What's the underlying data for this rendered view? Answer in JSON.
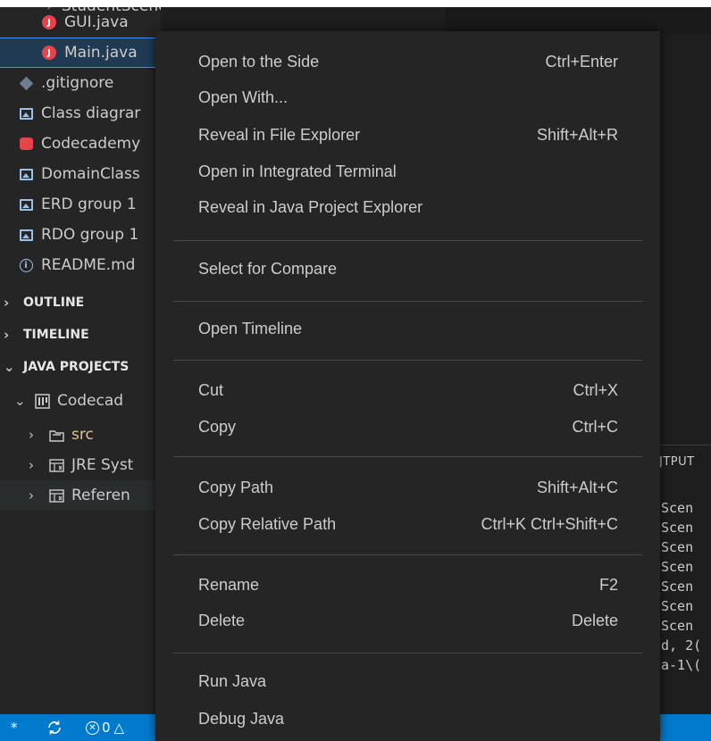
{
  "explorer": {
    "top_partial": "StudentScenes",
    "files": [
      {
        "name": "GUI.java",
        "icon": "java-icon"
      },
      {
        "name": "Main.java",
        "icon": "java-icon"
      },
      {
        "name": ".gitignore",
        "icon": "gitignore-icon"
      },
      {
        "name": "Class diagrar",
        "icon": "image-file-icon"
      },
      {
        "name": "Codecademy",
        "icon": "database-file-icon"
      },
      {
        "name": "DomainClass",
        "icon": "image-file-icon"
      },
      {
        "name": "ERD group 1",
        "icon": "image-file-icon"
      },
      {
        "name": "RDO group 1",
        "icon": "image-file-icon"
      },
      {
        "name": "README.md",
        "icon": "info-icon"
      }
    ],
    "sections": {
      "outline": "OUTLINE",
      "timeline": "TIMELINE",
      "java_projects": "JAVA PROJECTS"
    },
    "project": {
      "name": "Codecad",
      "children": [
        {
          "name": "src",
          "color": "#e2c08d"
        },
        {
          "name": "JRE Syst",
          "color": "#cccccc"
        },
        {
          "name": "Referen",
          "color": "#cccccc"
        }
      ]
    }
  },
  "panel": {
    "tab_label": "JTPUT",
    "lines": [
      "Scen",
      "Scen",
      "Scen",
      "Scen",
      "Scen",
      "Scen",
      "Scen",
      "d, 2(",
      "a-1\\("
    ]
  },
  "statusbar": {
    "left_char": "*",
    "errors": "0",
    "warning_glyph": "△"
  },
  "context_menu": {
    "groups": [
      [
        {
          "label": "Open to the Side",
          "shortcut": "Ctrl+Enter"
        },
        {
          "label": "Open With...",
          "shortcut": ""
        },
        {
          "label": "Reveal in File Explorer",
          "shortcut": "Shift+Alt+R"
        },
        {
          "label": "Open in Integrated Terminal",
          "shortcut": ""
        },
        {
          "label": "Reveal in Java Project Explorer",
          "shortcut": ""
        }
      ],
      [
        {
          "label": "Select for Compare",
          "shortcut": ""
        }
      ],
      [
        {
          "label": "Open Timeline",
          "shortcut": ""
        }
      ],
      [
        {
          "label": "Cut",
          "shortcut": "Ctrl+X"
        },
        {
          "label": "Copy",
          "shortcut": "Ctrl+C"
        }
      ],
      [
        {
          "label": "Copy Path",
          "shortcut": "Shift+Alt+C"
        },
        {
          "label": "Copy Relative Path",
          "shortcut": "Ctrl+K Ctrl+Shift+C"
        }
      ],
      [
        {
          "label": "Rename",
          "shortcut": "F2"
        },
        {
          "label": "Delete",
          "shortcut": "Delete"
        }
      ],
      [
        {
          "label": "Run Java",
          "shortcut": ""
        },
        {
          "label": "Debug Java",
          "shortcut": ""
        }
      ]
    ]
  },
  "colors": {
    "accent": "#007acc",
    "menu_bg": "#252526",
    "java_red": "#e8434a",
    "selection_border": "#3794ff"
  }
}
